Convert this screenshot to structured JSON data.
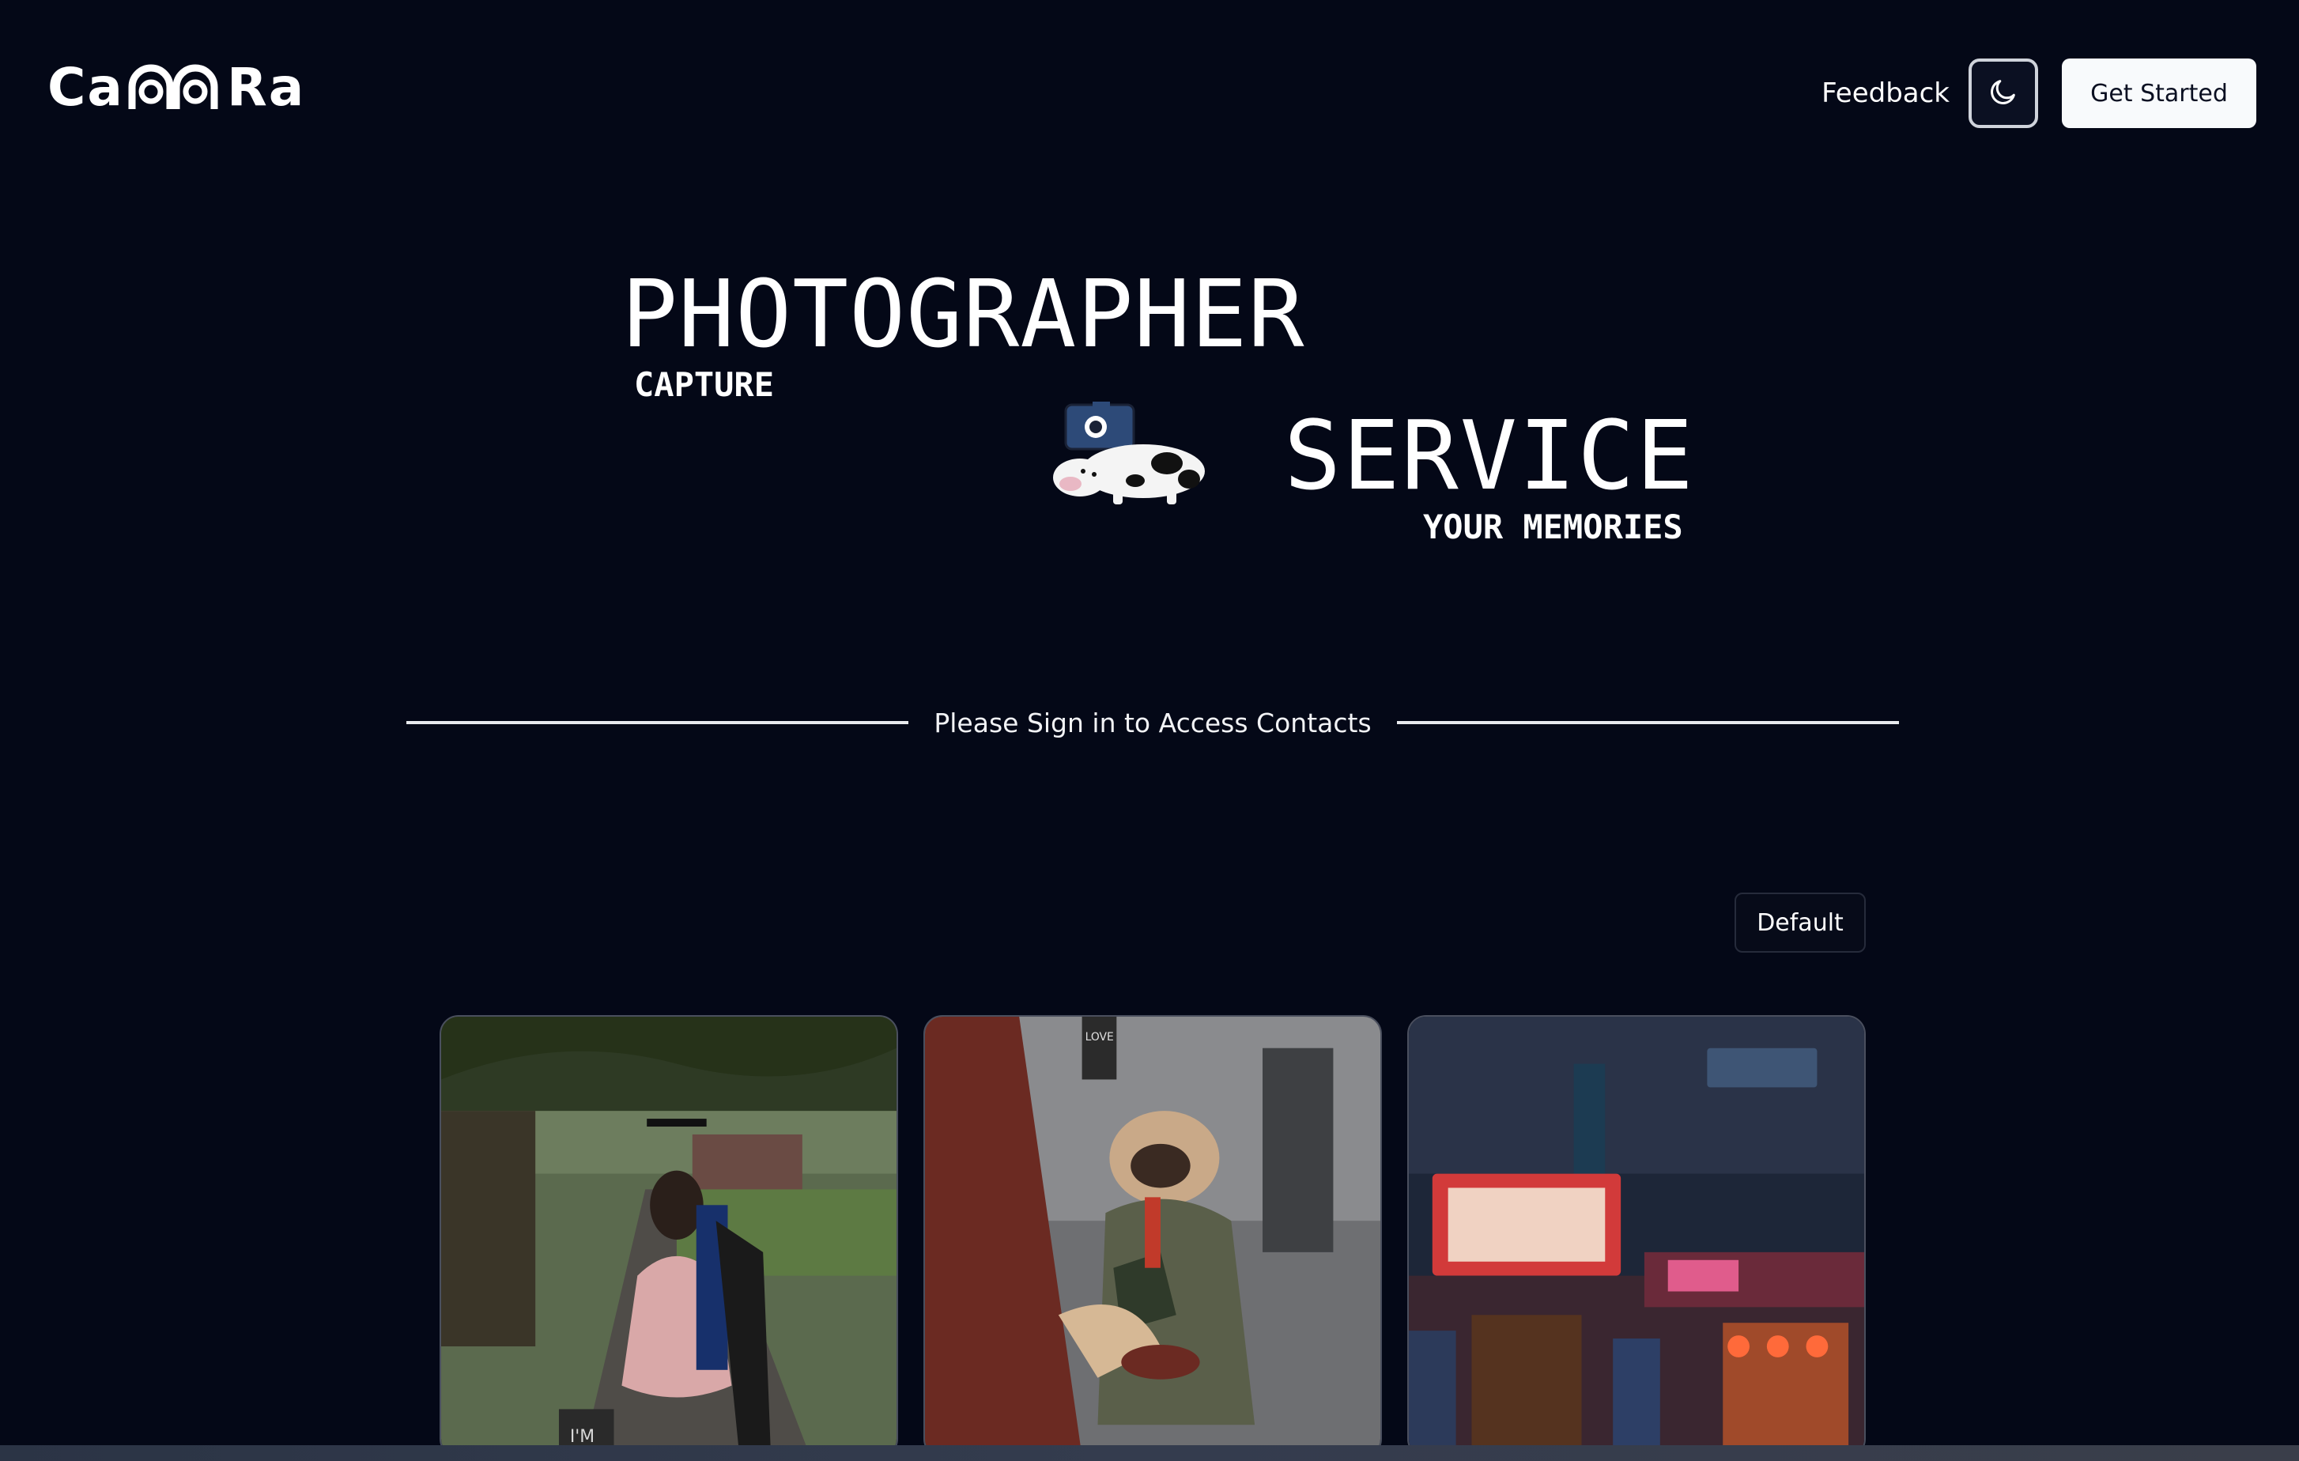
{
  "header": {
    "logo_text_left": "Ca",
    "logo_text_right": "Ra",
    "feedback_label": "Feedback",
    "theme_icon": "moon-icon",
    "get_started_label": "Get Started"
  },
  "hero": {
    "word_1": "PHOTOGRAPHER",
    "word_2": "CAPTURE",
    "word_3": "SERVICE",
    "word_4": "YOUR MEMORIES",
    "mascot_icon": "cow-camera-mascot"
  },
  "contacts": {
    "message": "Please Sign in to Access Contacts"
  },
  "gallery": {
    "sort_label": "Default",
    "cards": [
      {
        "name": "graduation-photo",
        "overlay_text": "I'M"
      },
      {
        "name": "pug-photo",
        "overlay_text": "LOVE"
      },
      {
        "name": "night-street-photo",
        "overlay_text": ""
      }
    ]
  },
  "colors": {
    "background": "#040817",
    "text": "#ffffff",
    "button_light": "#f8fafc"
  }
}
